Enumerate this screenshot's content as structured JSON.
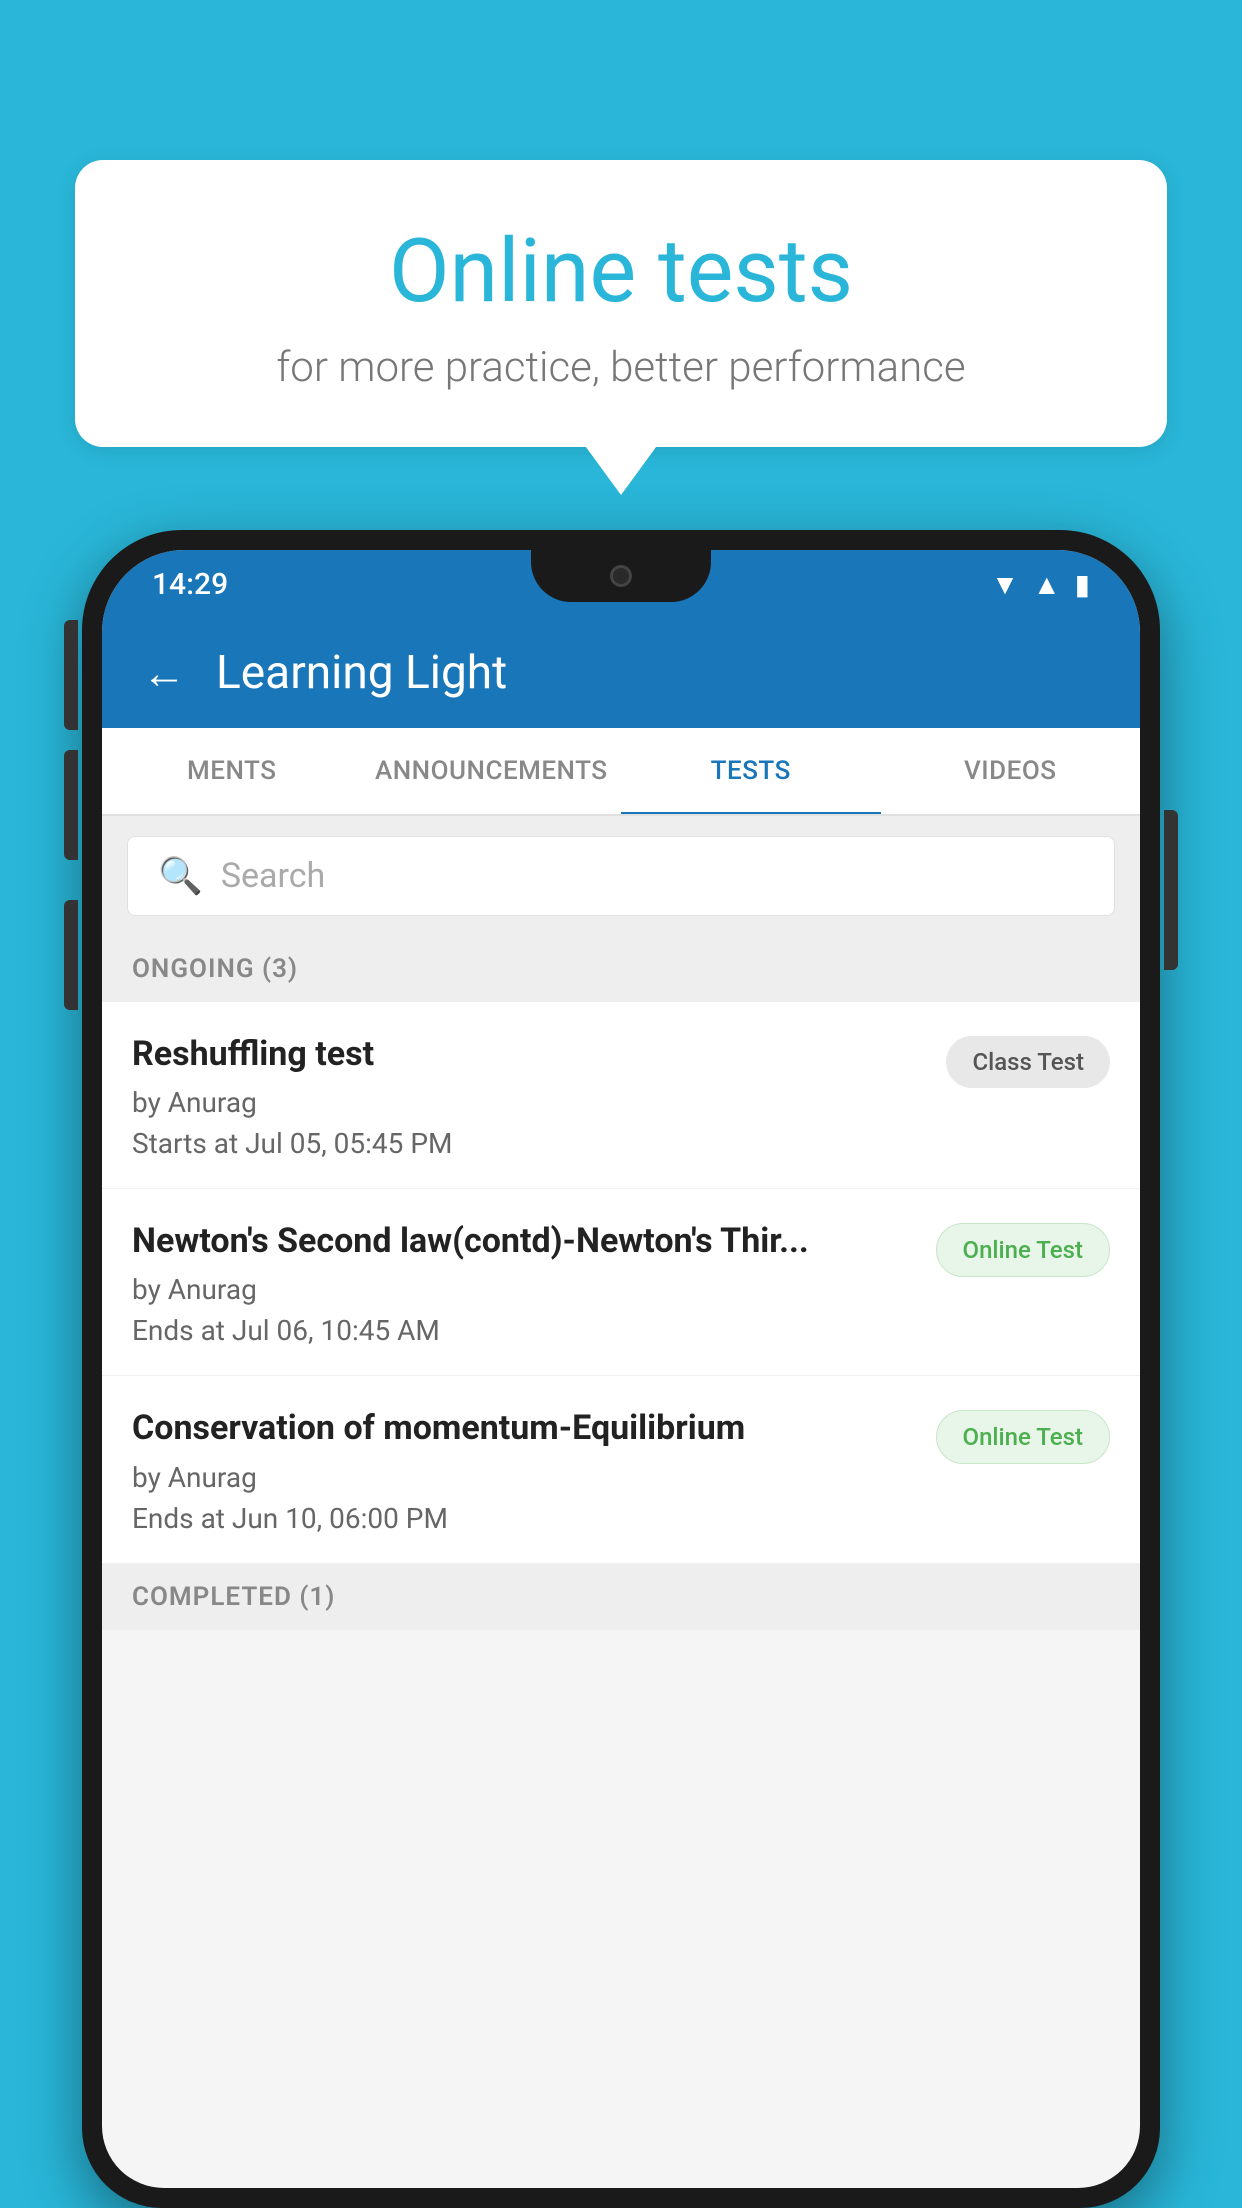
{
  "background_color": "#29b6d8",
  "speech_bubble": {
    "title": "Online tests",
    "subtitle": "for more practice, better performance"
  },
  "phone": {
    "status_bar": {
      "time": "14:29",
      "icons": [
        "wifi",
        "signal",
        "battery"
      ]
    },
    "app_bar": {
      "title": "Learning Light",
      "back_label": "←"
    },
    "tabs": [
      {
        "label": "MENTS",
        "active": false
      },
      {
        "label": "ANNOUNCEMENTS",
        "active": false
      },
      {
        "label": "TESTS",
        "active": true
      },
      {
        "label": "VIDEOS",
        "active": false
      }
    ],
    "search": {
      "placeholder": "Search"
    },
    "ongoing_section": {
      "label": "ONGOING (3)"
    },
    "tests": [
      {
        "title": "Reshuffling test",
        "author": "by Anurag",
        "date": "Starts at  Jul 05, 05:45 PM",
        "badge": "Class Test",
        "badge_type": "class"
      },
      {
        "title": "Newton's Second law(contd)-Newton's Thir...",
        "author": "by Anurag",
        "date": "Ends at  Jul 06, 10:45 AM",
        "badge": "Online Test",
        "badge_type": "online"
      },
      {
        "title": "Conservation of momentum-Equilibrium",
        "author": "by Anurag",
        "date": "Ends at  Jun 10, 06:00 PM",
        "badge": "Online Test",
        "badge_type": "online"
      }
    ],
    "completed_section": {
      "label": "COMPLETED (1)"
    }
  }
}
